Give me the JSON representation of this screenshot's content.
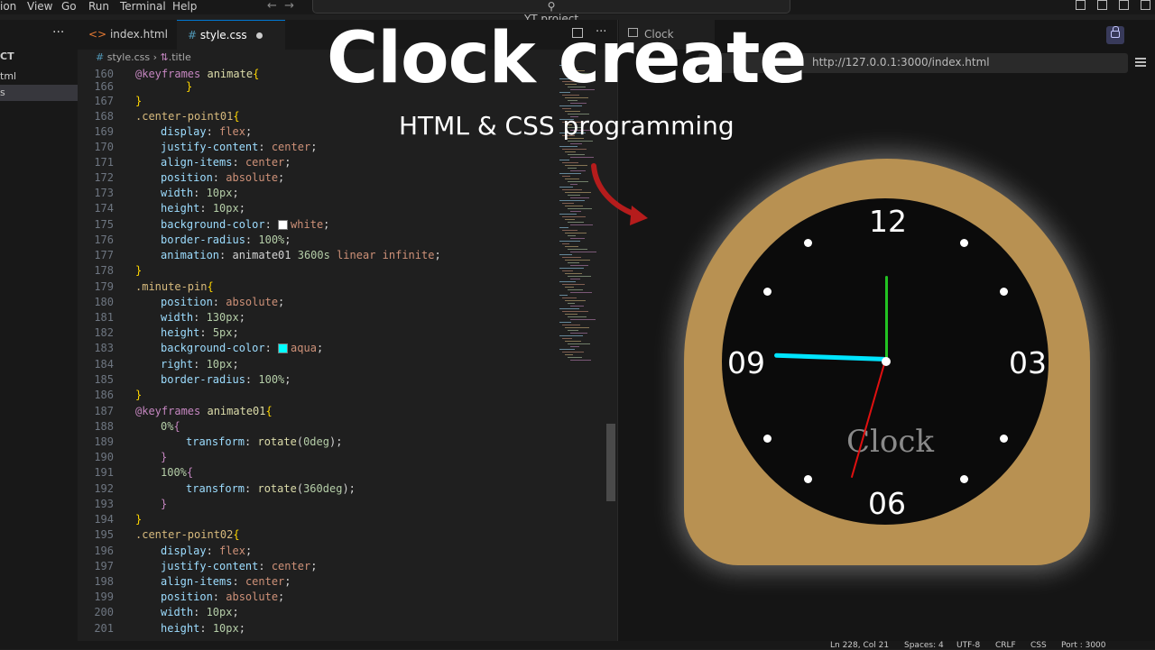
{
  "menubar": {
    "items": [
      "ion",
      "View",
      "Go",
      "Run",
      "Terminal",
      "Help"
    ],
    "search": "YT project"
  },
  "explorer": {
    "title": "CT",
    "files": [
      "tml",
      "s"
    ]
  },
  "editor": {
    "tabs": [
      {
        "label": "index.html",
        "icon": "<>"
      },
      {
        "label": "style.css",
        "icon": "#"
      }
    ],
    "breadcrumb": {
      "file": "style.css",
      "symbol": ".title"
    },
    "line_numbers": [
      "160",
      "166",
      "167",
      "168",
      "169",
      "170",
      "171",
      "172",
      "173",
      "174",
      "175",
      "176",
      "177",
      "178",
      "179",
      "180",
      "181",
      "182",
      "183",
      "184",
      "185",
      "186",
      "187",
      "188",
      "189",
      "190",
      "191",
      "192",
      "193",
      "194",
      "195",
      "196",
      "197",
      "198",
      "199",
      "200",
      "201"
    ]
  },
  "preview": {
    "tab_label": "Clock",
    "url_fragment": "http://127.0.0.1:3000/index.html"
  },
  "overlay": {
    "title": "Clock create",
    "subtitle": "HTML & CSS programming"
  },
  "clock": {
    "numerals": {
      "top": "12",
      "right": "03",
      "bottom": "06",
      "left": "09"
    },
    "label": "Clock",
    "hand_colors": {
      "hour": "#00e5ff",
      "minute": "#22c322",
      "second": "#e01010"
    },
    "body_color": "#b89152"
  },
  "statusbar": {
    "position": "Ln 228, Col 21",
    "spaces": "Spaces: 4",
    "encoding": "UTF-8",
    "eol": "CRLF",
    "language": "CSS",
    "port": "Port : 3000"
  },
  "colors": {
    "accent": "#0078d4",
    "swatch_white": "#ffffff",
    "swatch_aqua": "#00ffff"
  }
}
